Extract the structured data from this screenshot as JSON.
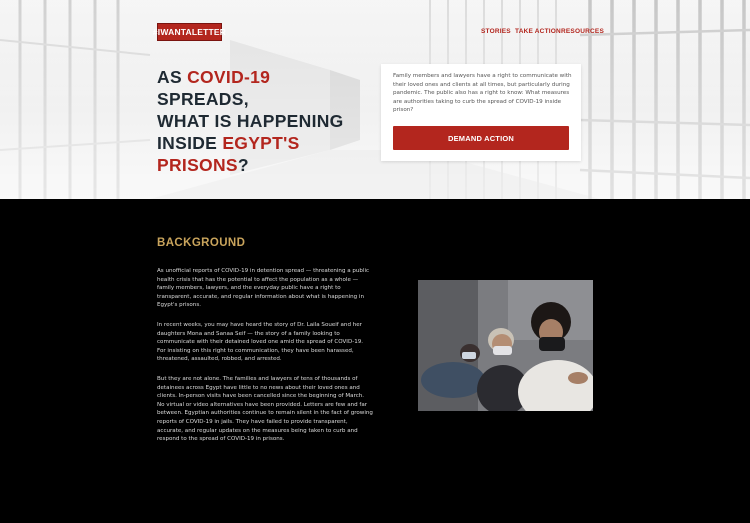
{
  "brand": {
    "logo_text": "#IWANTALETTER"
  },
  "nav": {
    "items": [
      "STORIES",
      "TAKE ACTION",
      "RESOURCES"
    ]
  },
  "hero": {
    "headline": {
      "line1_prefix": "AS ",
      "line1_highlight": "COVID-19",
      "line1_suffix": " SPREADS,",
      "line2": "WHAT IS HAPPENING",
      "line3_prefix": "INSIDE ",
      "line3_highlight": "EGYPT'S",
      "line4_highlight": "PRISONS",
      "line4_suffix": "?"
    },
    "card_text": "Family members and lawyers have a right to communicate with their loved ones and clients at all times, but particularly during pandemic. The public also has a right to know: What measures are authorities taking to curb the spread of COVID-19 inside prison?",
    "cta_label": "DEMAND ACTION"
  },
  "background": {
    "title": "BACKGROUND",
    "paragraphs": [
      "As unofficial reports of COVID-19 in detention spread — threatening a public health crisis that has the potential to affect the population as a whole — family members, lawyers, and the everyday public have a right to transparent, accurate, and regular information about what is happening in Egypt's prisons.",
      "In recent weeks, you may have heard the story of Dr. Laila Soueif and her daughters Mona and Sanaa Seif — the story of a family looking to communicate with their detained loved one amid the spread of COVID-19. For insisting on this right to communication, they have been harassed, threatened, assaulted, robbed, and arrested.",
      "But they are not alone. The families and lawyers of tens of thousands of detainees across Egypt have little to no news about their loved ones and clients. In-person visits have been cancelled since the beginning of March. No virtual or video alternatives have been provided. Letters are few and far between. Egyptian authorities continue to remain silent in the fact of growing reports of COVID-19 in jails. They have failed to provide transparent, accurate, and regular updates on the measures being taken to curb and respond to the spread of COVID-19 in prisons."
    ]
  },
  "colors": {
    "accent_red": "#b3261e",
    "gold": "#c9a45c",
    "navy": "#1f2a33"
  }
}
